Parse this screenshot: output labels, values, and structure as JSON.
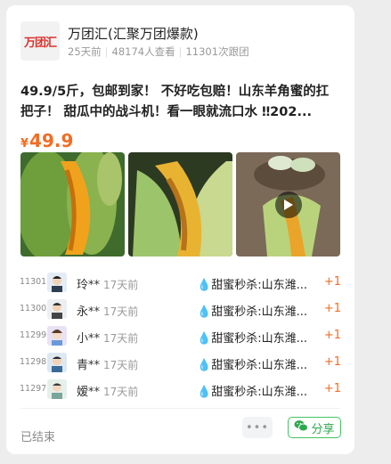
{
  "account": {
    "logo_text": "万团汇",
    "name": "万团汇(汇聚万团爆款)",
    "posted": "25天前",
    "views": "48174人查看",
    "joins": "11301次跟团"
  },
  "product": {
    "title": "49.9/5斤，包邮到家！ 不好吃包赔！山东羊角蜜的扛把子！ 甜瓜中的战斗机！看一眼就流口水 ‼202...",
    "currency": "¥",
    "price": "49.9"
  },
  "gallery": {
    "images": [
      "melon-cut-photo",
      "melon-split-photo",
      "melon-video-thumbnail"
    ],
    "has_video": true
  },
  "orders": [
    {
      "num": "11301",
      "name": "玲**",
      "time": "17天前",
      "item": "甜蜜秒杀:山东潍...",
      "qty": "+1"
    },
    {
      "num": "11300",
      "name": "永**",
      "time": "17天前",
      "item": "甜蜜秒杀:山东潍...",
      "qty": "+1"
    },
    {
      "num": "11299",
      "name": "小**",
      "time": "17天前",
      "item": "甜蜜秒杀:山东潍...",
      "qty": "+1"
    },
    {
      "num": "11298",
      "name": "青**",
      "time": "17天前",
      "item": "甜蜜秒杀:山东潍...",
      "qty": "+1"
    },
    {
      "num": "11297",
      "name": "嫒**",
      "time": "17天前",
      "item": "甜蜜秒杀:山东潍...",
      "qty": "+1"
    }
  ],
  "footer": {
    "status": "已结束",
    "more": "•••",
    "share": "分享"
  },
  "colors": {
    "accent": "#f26c23",
    "share_green": "#2fa94f",
    "logo_red": "#d9332e"
  }
}
